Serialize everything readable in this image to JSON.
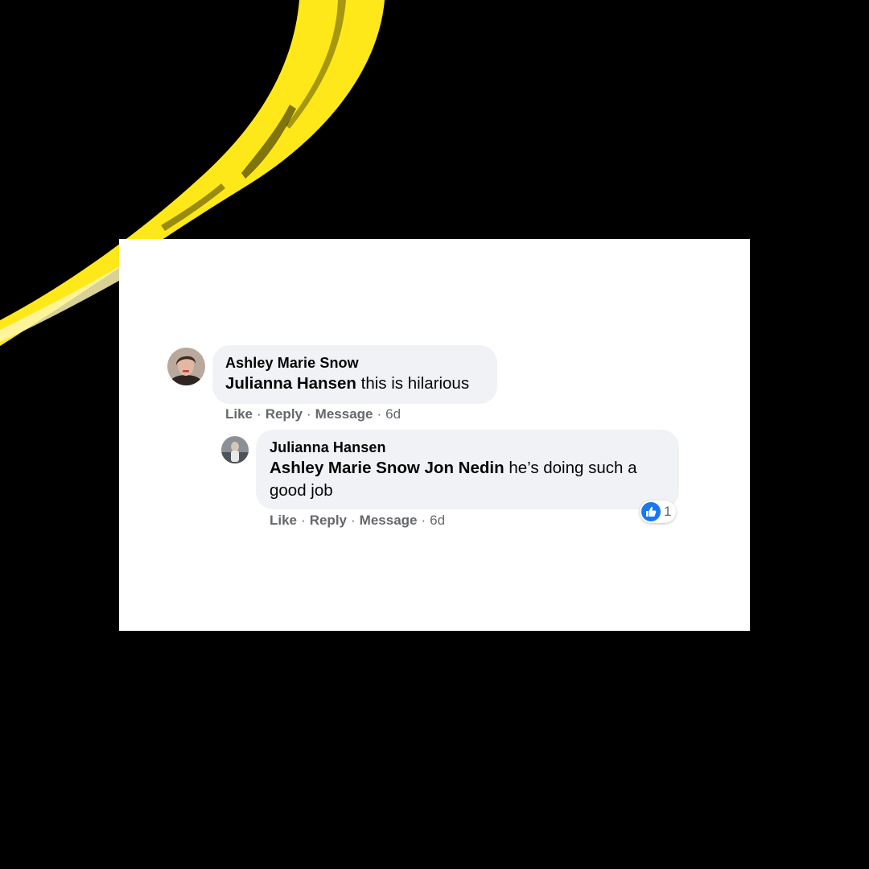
{
  "colors": {
    "background": "#000000",
    "brush": "#ffe81a",
    "bubble": "#f0f2f5",
    "like_blue": "#1877f2",
    "meta_text": "#65676b"
  },
  "comments": [
    {
      "author": "Ashley Marie Snow",
      "mention": "Julianna Hansen",
      "text": "this is hilarious",
      "actions": {
        "like": "Like",
        "reply": "Reply",
        "message": "Message",
        "time": "6d"
      }
    },
    {
      "author": "Julianna Hansen",
      "mention": "Ashley Marie Snow Jon Nedin",
      "text_line1": "he’s doing such a",
      "text_line2": "good job",
      "reaction": {
        "icon": "thumbs-up-icon",
        "count": "1"
      },
      "actions": {
        "like": "Like",
        "reply": "Reply",
        "message": "Message",
        "time": "6d"
      }
    }
  ]
}
